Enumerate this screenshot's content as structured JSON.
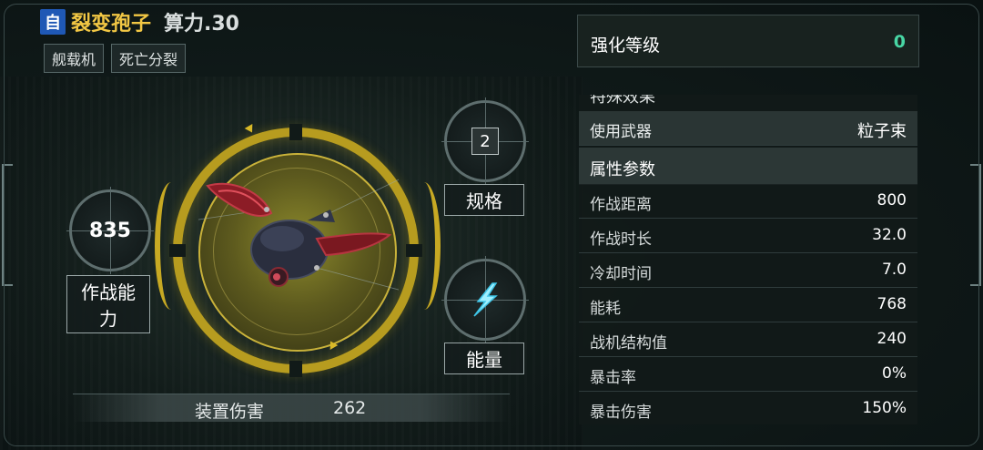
{
  "header": {
    "self_badge": "自",
    "unit_name": "裂变孢子",
    "power_label": "算力.30"
  },
  "tags": [
    "舰载机",
    "死亡分裂"
  ],
  "stats": {
    "combat_value": "835",
    "combat_label": "作战能力",
    "spec_value": "2",
    "spec_label": "规格",
    "energy_label": "能量"
  },
  "device_damage": {
    "label": "装置伤害",
    "value": "262"
  },
  "enhance": {
    "label": "强化等级",
    "value": "0"
  },
  "special_header": "特殊效果",
  "weapon": {
    "label": "使用武器",
    "value": "粒子束"
  },
  "attributes_header": "属性参数",
  "attributes": [
    {
      "label": "作战距离",
      "value": "800"
    },
    {
      "label": "作战时长",
      "value": "32.0"
    },
    {
      "label": "冷却时间",
      "value": "7.0"
    },
    {
      "label": "能耗",
      "value": "768"
    },
    {
      "label": "战机结构值",
      "value": "240"
    },
    {
      "label": "暴击率",
      "value": "0%"
    },
    {
      "label": "暴击伤害",
      "value": "150%"
    }
  ],
  "colors": {
    "accent_gold": "#f2c744",
    "ring_gold": "#b79c1f",
    "self_badge_blue": "#1f58b5",
    "enhance_green": "#48d6a4"
  }
}
